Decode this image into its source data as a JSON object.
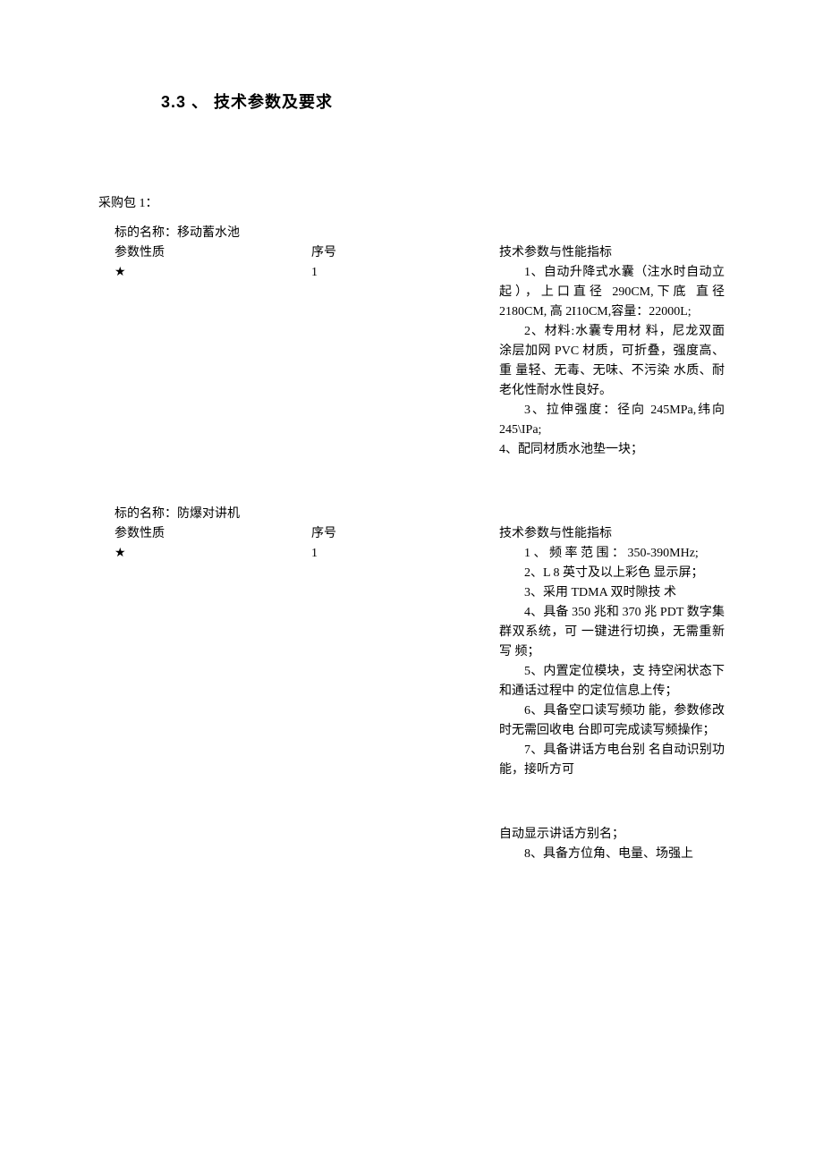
{
  "heading": "3.3 、 技术参数及要求",
  "package_label": "采购包 1：",
  "items": [
    {
      "name_label": "标的名称：移动蓄水池",
      "param_nature_label": "参数性质",
      "seq_label": "序号",
      "tech_label": "技术参数与性能指标",
      "star": "★",
      "seq_value": "1",
      "paras": [
        {
          "text": "1、自动升降式水囊（注水时自动立起），上口直径 290CM,下底 直径 2180CM, 高 2I10CM,容量：22000L;",
          "indent": true
        },
        {
          "text": "2、材料:水囊专用材 料，尼龙双面涂层加网 PVC 材质，可折叠，强度高、重 量轻、无毒、无味、不污染 水质、耐老化性耐水性良好。",
          "indent": true
        },
        {
          "text": "3、拉伸强度：径向 245MPa,纬向 245\\IPa;",
          "indent": true
        },
        {
          "text": "4、配同材质水池垫一块；",
          "indent": false
        }
      ]
    },
    {
      "name_label": "标的名称：防爆对讲机",
      "param_nature_label": "参数性质",
      "seq_label": "序号",
      "tech_label": "技术参数与性能指标",
      "star": "★",
      "seq_value": "1",
      "paras": [
        {
          "text": "1 、 频 率 范 围 ：  350-390MHz;",
          "indent": true
        },
        {
          "text": "2、L 8 英寸及以上彩色 显示屏；",
          "indent": true
        },
        {
          "text": "3、采用 TDMA 双时隙技 术",
          "indent": true
        },
        {
          "text": "4、具备 350 兆和 370 兆 PDT 数字集群双系统，可 一键进行切换，无需重新写 频；",
          "indent": true
        },
        {
          "text": "5、内置定位模块，支 持空闲状态下和通话过程中 的定位信息上传；",
          "indent": true
        },
        {
          "text": "6、具备空口读写频功 能，参数修改时无需回收电 台即可完成读写频操作；",
          "indent": true
        },
        {
          "text": "7、具备讲话方电台别 名自动识别功能，接听方可",
          "indent": true
        }
      ]
    }
  ],
  "footer_paras": [
    {
      "text": "自动显示讲话方别名；",
      "indent": false
    },
    {
      "text": "8、具备方位角、电量、场强上",
      "indent": true
    }
  ]
}
